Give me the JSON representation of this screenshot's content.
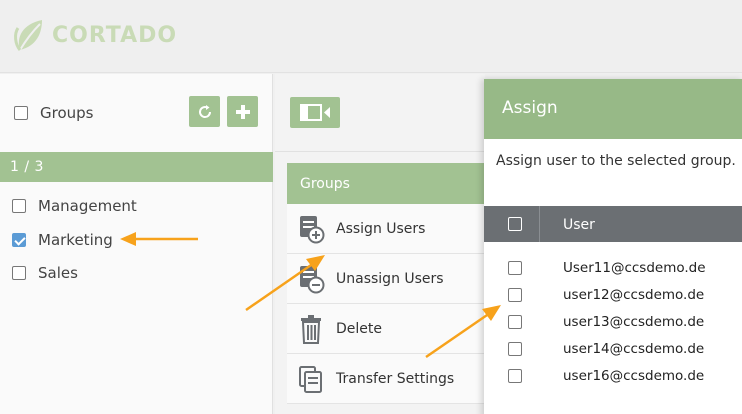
{
  "app": {
    "logo_text": "CORTADO"
  },
  "groups_panel": {
    "header_label": "Groups",
    "pager": "1 / 3",
    "items": [
      {
        "label": "Management",
        "checked": false
      },
      {
        "label": "Marketing",
        "checked": true
      },
      {
        "label": "Sales",
        "checked": false
      }
    ]
  },
  "menu": {
    "title": "Groups",
    "items": [
      {
        "label": "Assign Users",
        "icon": "assign-users-icon"
      },
      {
        "label": "Unassign Users",
        "icon": "unassign-users-icon"
      },
      {
        "label": "Delete",
        "icon": "trash-icon"
      },
      {
        "label": "Transfer Settings",
        "icon": "transfer-settings-icon"
      }
    ]
  },
  "dialog": {
    "title": "Assign",
    "description": "Assign user to the selected group.",
    "column_user": "User",
    "users": [
      "User11@ccsdemo.de",
      "user12@ccsdemo.de",
      "user13@ccsdemo.de",
      "user14@ccsdemo.de",
      "user16@ccsdemo.de"
    ]
  },
  "colors": {
    "accent_green": "#a2c292",
    "dialog_header": "#97b987",
    "table_header": "#6b6f73",
    "annotation_arrow": "#f7a21b",
    "checkbox_checked": "#5b9bd5"
  }
}
